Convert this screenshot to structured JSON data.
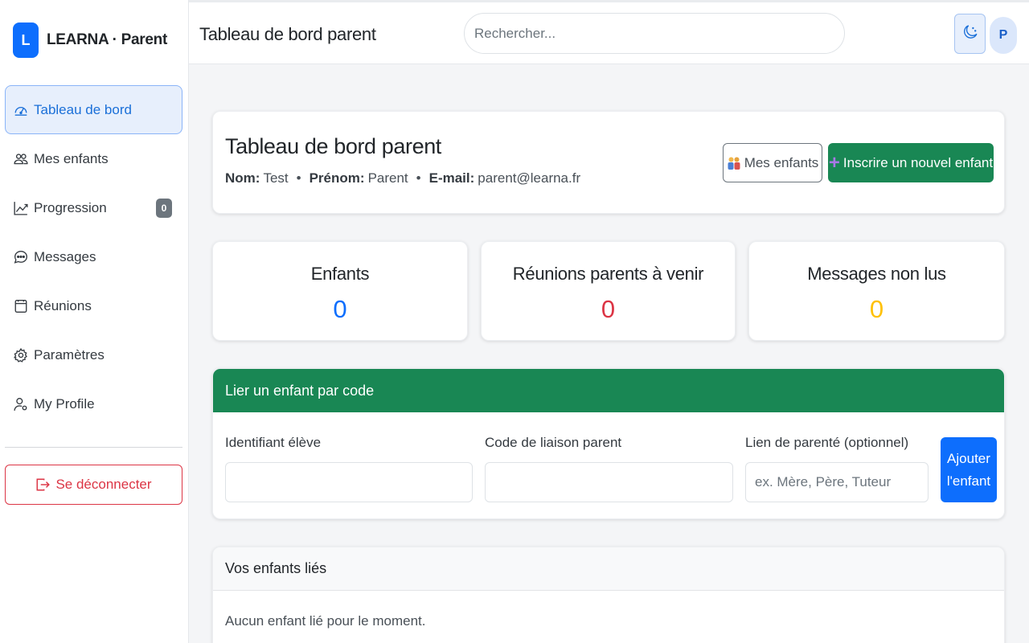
{
  "sidebar": {
    "brand": {
      "logo_letter": "L",
      "name": "LEARNA · Parent"
    },
    "items": [
      {
        "label": "Tableau de bord",
        "icon": "dashboard-icon",
        "active": true
      },
      {
        "label": "Mes enfants",
        "icon": "people-icon"
      },
      {
        "label": "Progression",
        "icon": "graph-up-icon",
        "badge": "0"
      },
      {
        "label": "Messages",
        "icon": "chat-icon"
      },
      {
        "label": "Réunions",
        "icon": "calendar-icon"
      },
      {
        "label": "Paramètres",
        "icon": "gear-icon"
      },
      {
        "label": "My Profile",
        "icon": "person-gear-icon"
      }
    ],
    "logout_label": "Se déconnecter"
  },
  "topbar": {
    "title": "Tableau de bord parent",
    "search_placeholder": "Rechercher...",
    "theme_icon": "moon-stars-icon",
    "avatar_letter": "P"
  },
  "header_card": {
    "title": "Tableau de bord parent",
    "nom_label": "Nom:",
    "nom_value": "Test",
    "prenom_label": "Prénom:",
    "prenom_value": "Parent",
    "email_label": "E-mail:",
    "email_value": "parent@learna.fr",
    "separator": "•",
    "mes_enfants_button": "Mes enfants",
    "inscrire_button": "Inscrire un nouvel enfant",
    "inscrire_icon": "plus-icon"
  },
  "stats": [
    {
      "label": "Enfants",
      "value": "0",
      "color": "#0d6efd"
    },
    {
      "label": "Réunions parents à venir",
      "value": "0",
      "color": "#dc3545"
    },
    {
      "label": "Messages non lus",
      "value": "0",
      "color": "#ffc107"
    }
  ],
  "link_child": {
    "title": "Lier un enfant par code",
    "student_id_label": "Identifiant élève",
    "student_id_value": "",
    "parent_code_label": "Code de liaison parent",
    "parent_code_value": "",
    "relation_label": "Lien de parenté (optionnel)",
    "relation_placeholder": "ex. Mère, Père, Tuteur",
    "add_button_line1": "Ajouter",
    "add_button_line2": "l'enfant"
  },
  "linked_children": {
    "title": "Vos enfants liés",
    "empty_text": "Aucun enfant lié pour le moment."
  },
  "colors": {
    "primary": "#0d6efd",
    "success": "#198754",
    "danger": "#dc3545",
    "warning": "#ffc107"
  }
}
